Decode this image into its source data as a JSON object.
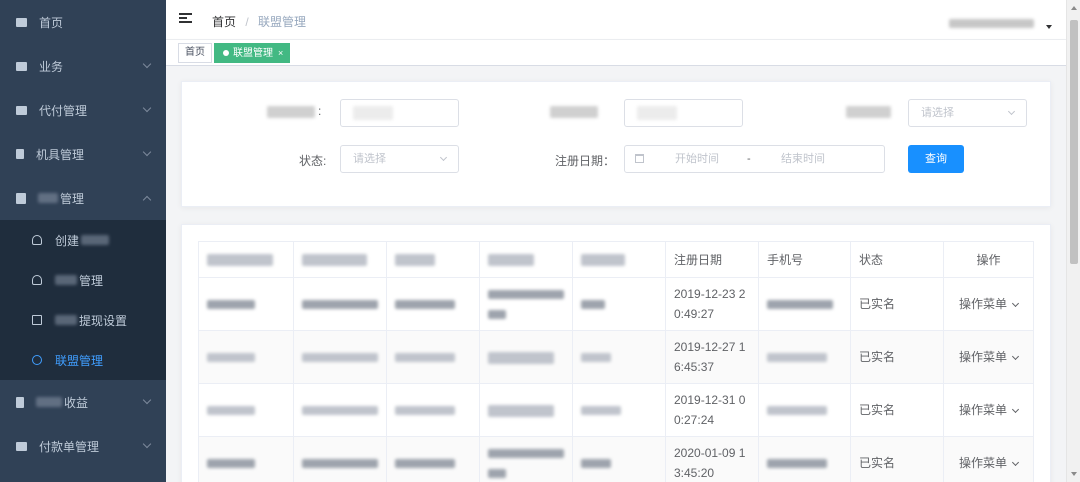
{
  "sidebar": {
    "items": [
      {
        "label": "首页",
        "icon": "dashboard-icon"
      },
      {
        "label": "业务",
        "icon": "briefcase-icon"
      },
      {
        "label": "代付管理",
        "icon": "table-icon"
      },
      {
        "label": "机具管理",
        "icon": "device-icon"
      },
      {
        "label": "管理",
        "icon": "folder-icon"
      }
    ],
    "submenu": [
      {
        "label": "创建",
        "icon": "user-icon"
      },
      {
        "label": "管理",
        "icon": "tree-icon"
      },
      {
        "label": "提现设置",
        "icon": "doc-icon"
      },
      {
        "label": "联盟管理",
        "icon": "circle-icon"
      }
    ],
    "items_after": [
      {
        "label": "收益",
        "icon": "database-icon"
      },
      {
        "label": "付款单管理",
        "icon": "wallet-icon"
      }
    ]
  },
  "navbar": {
    "breadcrumb_home": "首页",
    "breadcrumb_sep": "/",
    "breadcrumb_current": "联盟管理"
  },
  "tags": {
    "home": "首页",
    "active": "联盟管理",
    "close": "×"
  },
  "filters": {
    "select_placeholder": "请选择",
    "colon": ":",
    "status_label": "状态:",
    "status_placeholder": "请选择",
    "reg_date_label": "注册日期：",
    "start_placeholder": "开始时间",
    "range_sep": "-",
    "end_placeholder": "结束时间",
    "query_button": "查询"
  },
  "table": {
    "headers": [
      "注册日期",
      "手机号",
      "状态",
      "操作"
    ],
    "rows": [
      {
        "date": "2019-12-23 2 0:49:27",
        "status": "已实名",
        "op": "操作菜单"
      },
      {
        "date": "2019-12-27 1 6:45:37",
        "status": "已实名",
        "op": "操作菜单"
      },
      {
        "date": "2019-12-31 0 0:27:24",
        "status": "已实名",
        "op": "操作菜单"
      },
      {
        "date": "2020-01-09 1 3:45:20",
        "status": "已实名",
        "op": "操作菜单"
      }
    ]
  },
  "colors": {
    "sidebar_bg": "#304156",
    "submenu_bg": "#1f2d3d",
    "active_link": "#409eff",
    "tag_active": "#42b983",
    "primary_button": "#1890ff"
  }
}
